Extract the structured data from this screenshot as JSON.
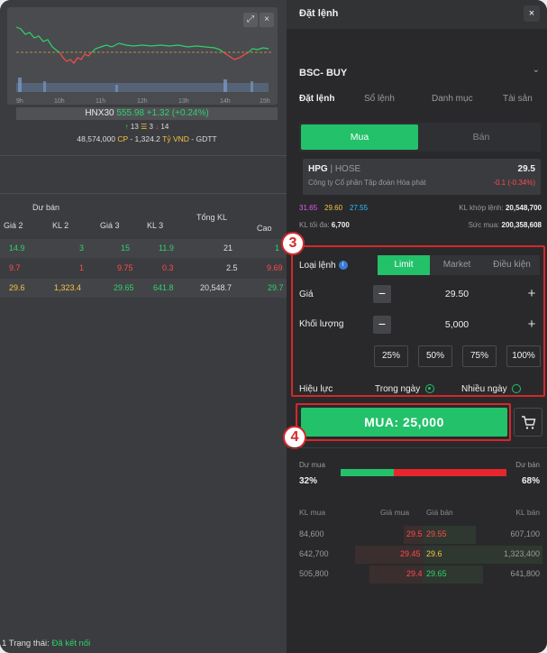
{
  "left": {
    "chart": {
      "time_ticks": [
        "9h",
        "10h",
        "11h",
        "12h",
        "13h",
        "14h",
        "15h"
      ],
      "expand_icon": "expand-icon",
      "close_icon": "close-icon"
    },
    "index": {
      "name": "HNX30",
      "value_change": "555.98 +1.32 (+0.24%)",
      "up_count": "13",
      "flat_count": "3",
      "down_count": "14",
      "volume": "48,574,000",
      "cp_label": "CP",
      "sep": " - ",
      "amount": "1,324.2",
      "amount_unit": "Tỷ VND",
      "session": "- GDTT"
    },
    "orderbook": {
      "group_label": "Dư bán",
      "headers": [
        "Giá 2",
        "KL 2",
        "Giá 3",
        "KL 3",
        "Tổng KL",
        "Cao"
      ],
      "rows": [
        [
          "14.9",
          "3",
          "15",
          "11.9",
          "21",
          "1"
        ],
        [
          "9.7",
          "1",
          "9.75",
          "0.3",
          "2.5",
          "9.69"
        ],
        [
          "29.6",
          "1,323.4",
          "29.65",
          "641.8",
          "20,548.7",
          "29.7"
        ]
      ]
    },
    "status_prefix": "1 Trạng thái:",
    "status_value": "Đã kết nối"
  },
  "right": {
    "title": "Đặt lệnh",
    "account": "BSC- BUY",
    "tabs": [
      "Đặt lệnh",
      "Sổ lệnh",
      "Danh mục",
      "Tài sản"
    ],
    "side_buy": "Mua",
    "side_sell": "Bán",
    "stock": {
      "code": "HPG",
      "exchange": "| HOSE",
      "price": "29.5",
      "company": "Công ty Cổ phần Tập đoàn Hòa phát",
      "change": "-0.1 (-0.34%)"
    },
    "ref_prices": {
      "ceiling": "31.65",
      "reference": "29.60",
      "floor": "27.55"
    },
    "matched_label": "KL khớp lệnh:",
    "matched_value": "20,548,700",
    "max_label": "KL tối đa:",
    "max_value": "6,700",
    "power_label": "Sức mua:",
    "power_value": "200,358,608",
    "form": {
      "order_type_label": "Loại lệnh",
      "order_types": [
        "Limit",
        "Market",
        "Điều kiện"
      ],
      "price_label": "Giá",
      "price_value": "29.50",
      "qty_label": "Khối lượng",
      "qty_value": "5,000",
      "percents": [
        "25%",
        "50%",
        "75%",
        "100%"
      ],
      "validity_label": "Hiệu lực",
      "validity_day": "Trong ngày",
      "validity_multi": "Nhiều ngày"
    },
    "submit_label": "MUA: 25,000",
    "callout_3": "3",
    "callout_4": "4",
    "sentiment": {
      "buy_label": "Dư mua",
      "buy_pct": "32%",
      "sell_label": "Dư bán",
      "sell_pct": "68%",
      "buy_fraction": 0.32
    },
    "book": {
      "headers": [
        "KL mua",
        "Giá mua",
        "Giá bán",
        "KL bán"
      ],
      "rows": [
        {
          "bid_qty": "84,600",
          "bid": "29.5",
          "ask": "29.55",
          "ask_qty": "607,100"
        },
        {
          "bid_qty": "642,700",
          "bid": "29.45",
          "ask": "29.6",
          "ask_qty": "1,323,400"
        },
        {
          "bid_qty": "505,800",
          "bid": "29.4",
          "ask": "29.65",
          "ask_qty": "641,800"
        }
      ]
    }
  }
}
